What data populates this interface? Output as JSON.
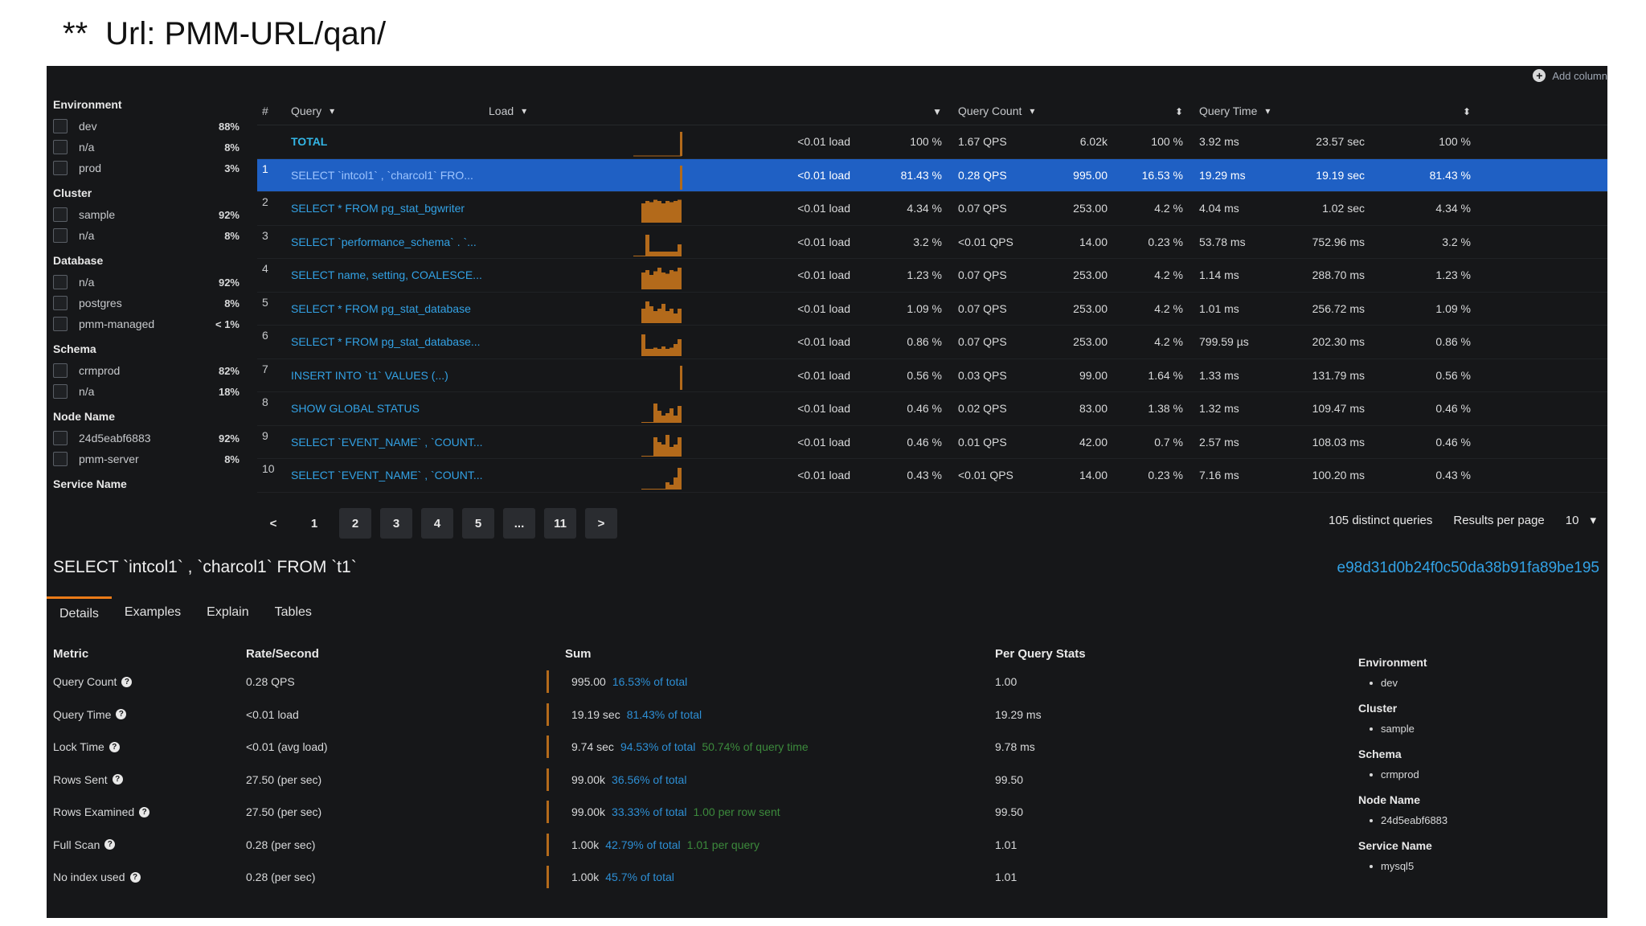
{
  "caption": {
    "stars": "**",
    "text": "Url: PMM-URL/qan/"
  },
  "add_column": "Add column",
  "filters": [
    {
      "title": "Environment",
      "items": [
        {
          "label": "dev",
          "pct": "88%"
        },
        {
          "label": "n/a",
          "pct": "8%"
        },
        {
          "label": "prod",
          "pct": "3%"
        }
      ]
    },
    {
      "title": "Cluster",
      "items": [
        {
          "label": "sample",
          "pct": "92%"
        },
        {
          "label": "n/a",
          "pct": "8%"
        }
      ]
    },
    {
      "title": "Database",
      "items": [
        {
          "label": "n/a",
          "pct": "92%"
        },
        {
          "label": "postgres",
          "pct": "8%"
        },
        {
          "label": "pmm-managed",
          "pct": "< 1%"
        }
      ]
    },
    {
      "title": "Schema",
      "items": [
        {
          "label": "crmprod",
          "pct": "82%"
        },
        {
          "label": "n/a",
          "pct": "18%"
        }
      ]
    },
    {
      "title": "Node Name",
      "items": [
        {
          "label": "24d5eabf6883",
          "pct": "92%"
        },
        {
          "label": "pmm-server",
          "pct": "8%"
        }
      ]
    },
    {
      "title": "Service Name",
      "items": []
    }
  ],
  "table": {
    "headers": {
      "num": "#",
      "query": "Query",
      "load": "Load",
      "query_count": "Query Count",
      "query_time": "Query Time"
    },
    "rows": [
      {
        "num": "",
        "query": "TOTAL",
        "load": "<0.01 load",
        "load_pct": "100 %",
        "qps": "1.67 QPS",
        "count": "6.02k",
        "count_pct": "100 %",
        "qt": "3.92 ms",
        "qt_sum": "23.57 sec",
        "qt_pct": "100 %",
        "spark": [
          0,
          0,
          0,
          0,
          0,
          0,
          0,
          0,
          0,
          0,
          0,
          0,
          0,
          0,
          0,
          0,
          0,
          0,
          0,
          0,
          0,
          0,
          1
        ]
      },
      {
        "num": "1",
        "query": "SELECT `intcol1` , `charcol1` FRO...",
        "load": "<0.01 load",
        "load_pct": "81.43 %",
        "qps": "0.28 QPS",
        "count": "995.00",
        "count_pct": "16.53 %",
        "qt": "19.29 ms",
        "qt_sum": "19.19 sec",
        "qt_pct": "81.43 %",
        "spark": [
          0,
          0,
          0,
          0,
          0,
          0,
          0,
          0,
          0,
          0,
          0,
          0,
          0,
          0,
          0,
          0,
          0,
          0,
          0,
          0,
          0,
          0,
          1
        ]
      },
      {
        "num": "2",
        "query": "SELECT * FROM pg_stat_bgwriter",
        "load": "<0.01 load",
        "load_pct": "4.34 %",
        "qps": "0.07 QPS",
        "count": "253.00",
        "count_pct": "4.2 %",
        "qt": "4.04 ms",
        "qt_sum": "1.02 sec",
        "qt_pct": "4.34 %",
        "spark": [
          0.8,
          0.9,
          0.85,
          0.95,
          0.9,
          0.8,
          0.9,
          0.85,
          0.9,
          0.95
        ]
      },
      {
        "num": "3",
        "query": "SELECT `performance_schema` . `...",
        "load": "<0.01 load",
        "load_pct": "3.2 %",
        "qps": "<0.01 QPS",
        "count": "14.00",
        "count_pct": "0.23 %",
        "qt": "53.78 ms",
        "qt_sum": "752.96 ms",
        "qt_pct": "3.2 %",
        "spark": [
          0,
          0,
          0,
          0.9,
          0.2,
          0.2,
          0.2,
          0.2,
          0.2,
          0.2,
          0.2,
          0.5
        ]
      },
      {
        "num": "4",
        "query": "SELECT name, setting, COALESCE...",
        "load": "<0.01 load",
        "load_pct": "1.23 %",
        "qps": "0.07 QPS",
        "count": "253.00",
        "count_pct": "4.2 %",
        "qt": "1.14 ms",
        "qt_sum": "288.70 ms",
        "qt_pct": "1.23 %",
        "spark": [
          0.7,
          0.8,
          0.6,
          0.75,
          0.9,
          0.7,
          0.65,
          0.8,
          0.75,
          0.9
        ]
      },
      {
        "num": "5",
        "query": "SELECT * FROM pg_stat_database",
        "load": "<0.01 load",
        "load_pct": "1.09 %",
        "qps": "0.07 QPS",
        "count": "253.00",
        "count_pct": "4.2 %",
        "qt": "1.01 ms",
        "qt_sum": "256.72 ms",
        "qt_pct": "1.09 %",
        "spark": [
          0.6,
          0.9,
          0.7,
          0.5,
          0.6,
          0.8,
          0.5,
          0.6,
          0.4,
          0.6
        ]
      },
      {
        "num": "6",
        "query": "SELECT * FROM pg_stat_database...",
        "load": "<0.01 load",
        "load_pct": "0.86 %",
        "qps": "0.07 QPS",
        "count": "253.00",
        "count_pct": "4.2 %",
        "qt": "799.59 µs",
        "qt_sum": "202.30 ms",
        "qt_pct": "0.86 %",
        "spark": [
          0.9,
          0.3,
          0.3,
          0.35,
          0.3,
          0.4,
          0.3,
          0.35,
          0.5,
          0.7
        ]
      },
      {
        "num": "7",
        "query": "INSERT INTO `t1` VALUES (...)",
        "load": "<0.01 load",
        "load_pct": "0.56 %",
        "qps": "0.03 QPS",
        "count": "99.00",
        "count_pct": "1.64 %",
        "qt": "1.33 ms",
        "qt_sum": "131.79 ms",
        "qt_pct": "0.56 %",
        "spark": [
          0,
          0,
          0,
          0,
          0,
          0,
          0,
          0,
          0,
          0,
          0,
          0,
          0,
          0,
          0,
          0,
          0,
          0,
          0,
          0,
          0,
          0,
          1
        ]
      },
      {
        "num": "8",
        "query": "SHOW GLOBAL STATUS",
        "load": "<0.01 load",
        "load_pct": "0.46 %",
        "qps": "0.02 QPS",
        "count": "83.00",
        "count_pct": "1.38 %",
        "qt": "1.32 ms",
        "qt_sum": "109.47 ms",
        "qt_pct": "0.46 %",
        "spark": [
          0,
          0,
          0,
          0.8,
          0.5,
          0.3,
          0.4,
          0.6,
          0.3,
          0.7
        ]
      },
      {
        "num": "9",
        "query": "SELECT `EVENT_NAME` , `COUNT...",
        "load": "<0.01 load",
        "load_pct": "0.46 %",
        "qps": "0.01 QPS",
        "count": "42.00",
        "count_pct": "0.7 %",
        "qt": "2.57 ms",
        "qt_sum": "108.03 ms",
        "qt_pct": "0.46 %",
        "spark": [
          0,
          0,
          0,
          0.8,
          0.6,
          0.5,
          0.9,
          0.4,
          0.5,
          0.8
        ]
      },
      {
        "num": "10",
        "query": "SELECT `EVENT_NAME` , `COUNT...",
        "load": "<0.01 load",
        "load_pct": "0.43 %",
        "qps": "<0.01 QPS",
        "count": "14.00",
        "count_pct": "0.23 %",
        "qt": "7.16 ms",
        "qt_sum": "100.20 ms",
        "qt_pct": "0.43 %",
        "spark": [
          0,
          0,
          0,
          0,
          0,
          0,
          0.3,
          0.2,
          0.5,
          0.9
        ]
      }
    ]
  },
  "pagination": {
    "prev": "<",
    "pages": [
      "1",
      "2",
      "3",
      "4",
      "5",
      "...",
      "11"
    ],
    "next": ">"
  },
  "pager_info": {
    "distinct": "105 distinct queries",
    "rpp_label": "Results per page",
    "rpp_value": "10"
  },
  "selected_query": {
    "text": "SELECT `intcol1` , `charcol1` FROM `t1`",
    "id": "e98d31d0b24f0c50da38b91fa89be195"
  },
  "tabs": [
    "Details",
    "Examples",
    "Explain",
    "Tables"
  ],
  "details": {
    "headers": {
      "metric": "Metric",
      "rate": "Rate/Second",
      "sum": "Sum",
      "per": "Per Query Stats"
    },
    "rows": [
      {
        "metric": "Query Count",
        "rate": "0.28 QPS",
        "sum": "995.00",
        "sum_blue": "16.53% of total",
        "sum_green": "",
        "per": "1.00"
      },
      {
        "metric": "Query Time",
        "rate": "<0.01 load",
        "sum": "19.19 sec",
        "sum_blue": "81.43% of total",
        "sum_green": "",
        "per": "19.29 ms"
      },
      {
        "metric": "Lock Time",
        "rate": "<0.01 (avg load)",
        "sum": "9.74 sec",
        "sum_blue": "94.53% of total",
        "sum_green": "50.74% of query time",
        "per": "9.78 ms"
      },
      {
        "metric": "Rows Sent",
        "rate": "27.50 (per sec)",
        "sum": "99.00k",
        "sum_blue": "36.56% of total",
        "sum_green": "",
        "per": "99.50"
      },
      {
        "metric": "Rows Examined",
        "rate": "27.50 (per sec)",
        "sum": "99.00k",
        "sum_blue": "33.33% of total",
        "sum_green": "1.00 per row sent",
        "per": "99.50"
      },
      {
        "metric": "Full Scan",
        "rate": "0.28 (per sec)",
        "sum": "1.00k",
        "sum_blue": "42.79% of total",
        "sum_green": "1.01 per query",
        "per": "1.01"
      },
      {
        "metric": "No index used",
        "rate": "0.28 (per sec)",
        "sum": "1.00k",
        "sum_blue": "45.7% of total",
        "sum_green": "",
        "per": "1.01"
      }
    ]
  },
  "labels": [
    {
      "title": "Environment",
      "value": "dev"
    },
    {
      "title": "Cluster",
      "value": "sample"
    },
    {
      "title": "Schema",
      "value": "crmprod"
    },
    {
      "title": "Node Name",
      "value": "24d5eabf6883"
    },
    {
      "title": "Service Name",
      "value": "mysql5"
    }
  ],
  "colors": {
    "accent": "#eb7b18",
    "selected_row": "#1f60c4",
    "link": "#33a2e5",
    "spark": "#b36a1b"
  }
}
